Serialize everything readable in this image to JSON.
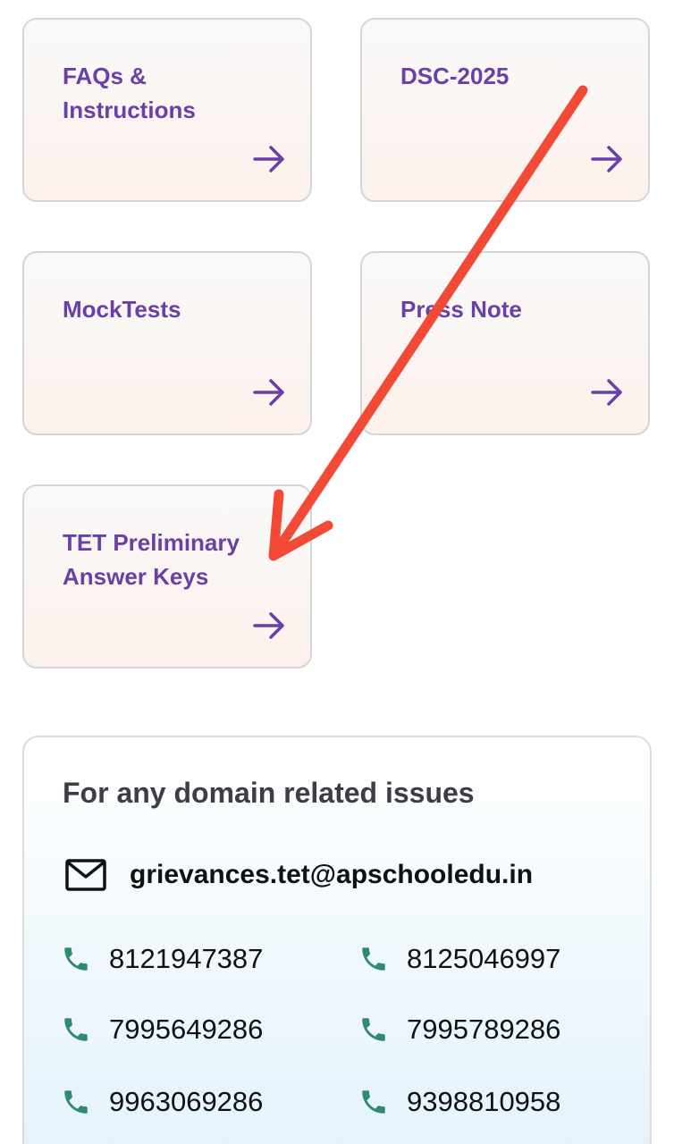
{
  "cards": [
    {
      "title": "FAQs & Instructions"
    },
    {
      "title": "DSC-2025"
    },
    {
      "title": "MockTests"
    },
    {
      "title": "Press Note"
    },
    {
      "title": "TET Preliminary Answer Keys"
    }
  ],
  "contact": {
    "heading": "For any domain related issues",
    "email": "grievances.tet@apschooledu.in",
    "phones": [
      "8121947387",
      "8125046997",
      "7995649286",
      "7995789286",
      "9963069286",
      "9398810958"
    ]
  },
  "icons": {
    "card_arrow": "arrow-right-icon",
    "email": "mail-icon",
    "phone": "phone-icon",
    "annotation": "red-arrow-annotation"
  },
  "colors": {
    "card_title": "#6a40a8",
    "arrow": "#6a40a8",
    "phone_icon": "#2f8a72",
    "annotation_arrow": "#f24a37"
  }
}
